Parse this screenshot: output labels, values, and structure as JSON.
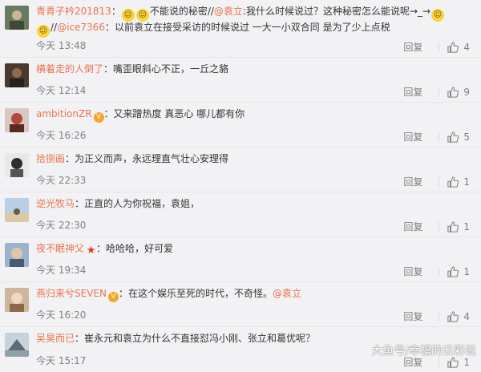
{
  "reply_label": "回复",
  "comments": [
    {
      "user": "青青子衿201813",
      "badge": null,
      "line1_segments": [
        {
          "t": "：",
          "k": "text"
        },
        {
          "t": "emoji",
          "k": "emoji"
        },
        {
          "t": "emoji",
          "k": "emoji"
        },
        {
          "t": "不能说的秘密//",
          "k": "text"
        },
        {
          "t": "@袁立",
          "k": "mention"
        },
        {
          "t": ":我什么时候说过？这种秘密怎么能说呢→_→",
          "k": "text"
        },
        {
          "t": "emoji",
          "k": "emoji"
        }
      ],
      "line2_segments": [
        {
          "t": "emoji",
          "k": "emoji"
        },
        {
          "t": "//",
          "k": "text"
        },
        {
          "t": "@ice7366",
          "k": "mention"
        },
        {
          "t": "：以前袁立在接受采访的时候说过 一大一小双合同 是为了少上点税",
          "k": "text"
        }
      ],
      "time": "今天 13:48",
      "likes": "4",
      "avatar_color": "#6b7a5e"
    },
    {
      "user": "横着走的人倒了",
      "badge": null,
      "text": "：嘴歪眼斜心不正，一丘之貉",
      "time": "今天 12:14",
      "likes": "9",
      "avatar_color": "#4a3a2e"
    },
    {
      "user": "ambitionZR",
      "badge": "vip",
      "text": "：又来蹭热度 真恶心 哪儿都有你",
      "time": "今天 16:26",
      "likes": "5",
      "avatar_color": "#b04a3c"
    },
    {
      "user": "拾捌画",
      "badge": null,
      "text": "：为正义而声，永远理直气壮心安理得",
      "time": "今天 22:33",
      "likes": "1",
      "avatar_color": "#2f2f2f"
    },
    {
      "user": "逆光牧马",
      "badge": null,
      "text": "：正直的人为你祝福，袁姐，",
      "time": "今天 22:30",
      "likes": "1",
      "avatar_color": "#8aa7c4"
    },
    {
      "user": "夜不眠神父",
      "badge": "star",
      "text": "：哈哈哈，好可爱",
      "time": "今天 19:34",
      "likes": "1",
      "avatar_color": "#5b6e8c"
    },
    {
      "user": "燕归来兮SEVEN",
      "badge": "vip",
      "text": "：在这个娱乐至死的时代，不奇怪。",
      "mention": "@袁立",
      "time": "今天 16:20",
      "likes": "4",
      "avatar_color": "#a98c6a"
    },
    {
      "user": "吴昊而已",
      "badge": null,
      "text": "：崔永元和袁立为什么不直接怼冯小刚、张立和葛优呢？",
      "time": "今天 15:17",
      "likes": "1",
      "avatar_color": "#7b8c9a"
    }
  ],
  "watermark": "大鱼号/幸福的云彩说",
  "icons": {
    "like": "thumbs-up-icon",
    "vip": "vip-badge-icon",
    "star": "star-badge-icon",
    "emoji": "emoji-icon"
  },
  "colors": {
    "username": "#eb7350",
    "meta": "#808080",
    "background": "#f2f2f5"
  }
}
